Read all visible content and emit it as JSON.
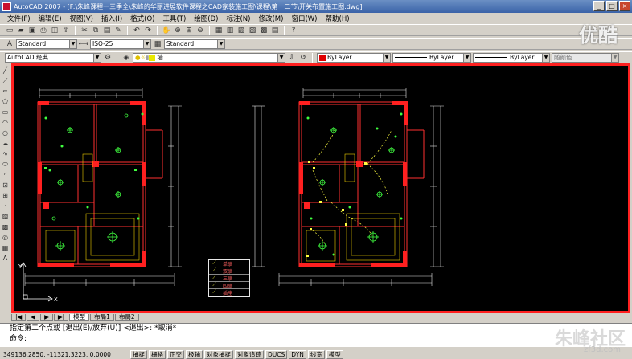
{
  "window": {
    "title": "AutoCAD 2007 - [F:\\朱峰课程一三季全\\朱峰的华丽进展软件课程之CAD家装施工图\\课程\\第十二节\\开关布置施工图.dwg]",
    "min": "_",
    "max": "□",
    "close": "×"
  },
  "menu": [
    "文件(F)",
    "编辑(E)",
    "视图(V)",
    "插入(I)",
    "格式(O)",
    "工具(T)",
    "绘图(D)",
    "标注(N)",
    "修改(M)",
    "窗口(W)",
    "帮助(H)"
  ],
  "toolbar2": {
    "text_style": "Standard",
    "dim_style": "ISO-25",
    "table_style": "Standard"
  },
  "toolbar3": {
    "workspace": "AutoCAD 经典",
    "layer": "墙",
    "color": "ByLayer",
    "linetype": "ByLayer",
    "lineweight": "ByLayer",
    "plotstyle": "随颜色"
  },
  "legend": [
    {
      "label": "单联"
    },
    {
      "label": "双联"
    },
    {
      "label": "三联"
    },
    {
      "label": "四联"
    },
    {
      "label": "插座"
    }
  ],
  "tabs": [
    "模型",
    "布局1",
    "布局2"
  ],
  "command": {
    "history": "指定第二个点或 [退出(E)/放弃(U)] <退出>:  *取消*",
    "prompt": "命令:"
  },
  "status": {
    "coords": "349136.2850, -11321.3223, 0.0000",
    "buttons": [
      "捕捉",
      "栅格",
      "正交",
      "极轴",
      "对象捕捉",
      "对象追踪",
      "DUCS",
      "DYN",
      "线宽",
      "模型"
    ]
  },
  "watermarks": {
    "top": "优酷",
    "bottom": "朱峰社区",
    "url": "zf3d.com"
  }
}
